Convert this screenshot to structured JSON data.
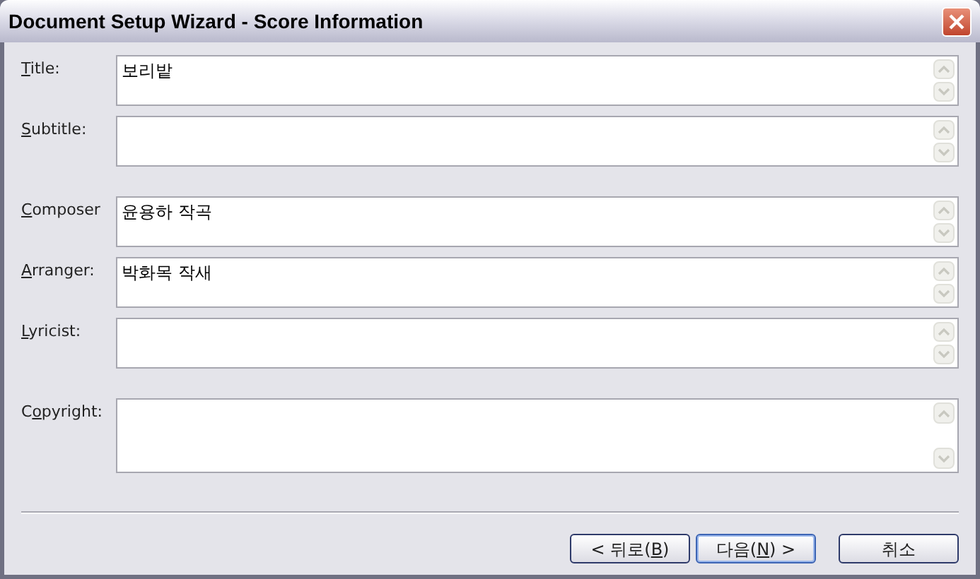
{
  "window": {
    "title": "Document Setup Wizard - Score Information"
  },
  "field_groups": [
    [
      {
        "label": {
          "key": "T",
          "after": "itle:"
        },
        "value": "보리밭",
        "kind": "short"
      },
      {
        "label": {
          "key": "S",
          "after": "ubtitle:"
        },
        "kind": "short"
      }
    ],
    [
      {
        "label": {
          "key": "C",
          "after": "omposer"
        },
        "value": "윤용하 작곡",
        "kind": "short"
      },
      {
        "label": {
          "key": "A",
          "after": "rranger:"
        },
        "value": "박화목 작새",
        "kind": "short"
      },
      {
        "label": {
          "key": "L",
          "after": "yricist:"
        },
        "kind": "short"
      }
    ],
    [
      {
        "label": {
          "before": "C",
          "key": "o",
          "after": "pyright:"
        },
        "kind": "tall"
      }
    ]
  ],
  "buttons": [
    {
      "label": {
        "before": "< 뒤로(",
        "key": "B",
        "after": ")"
      },
      "default": false
    },
    {
      "label": {
        "before": "다음(",
        "key": "N",
        "after": ") >"
      },
      "default": true
    },
    {
      "label": {
        "before": "취소"
      },
      "default": false
    }
  ]
}
